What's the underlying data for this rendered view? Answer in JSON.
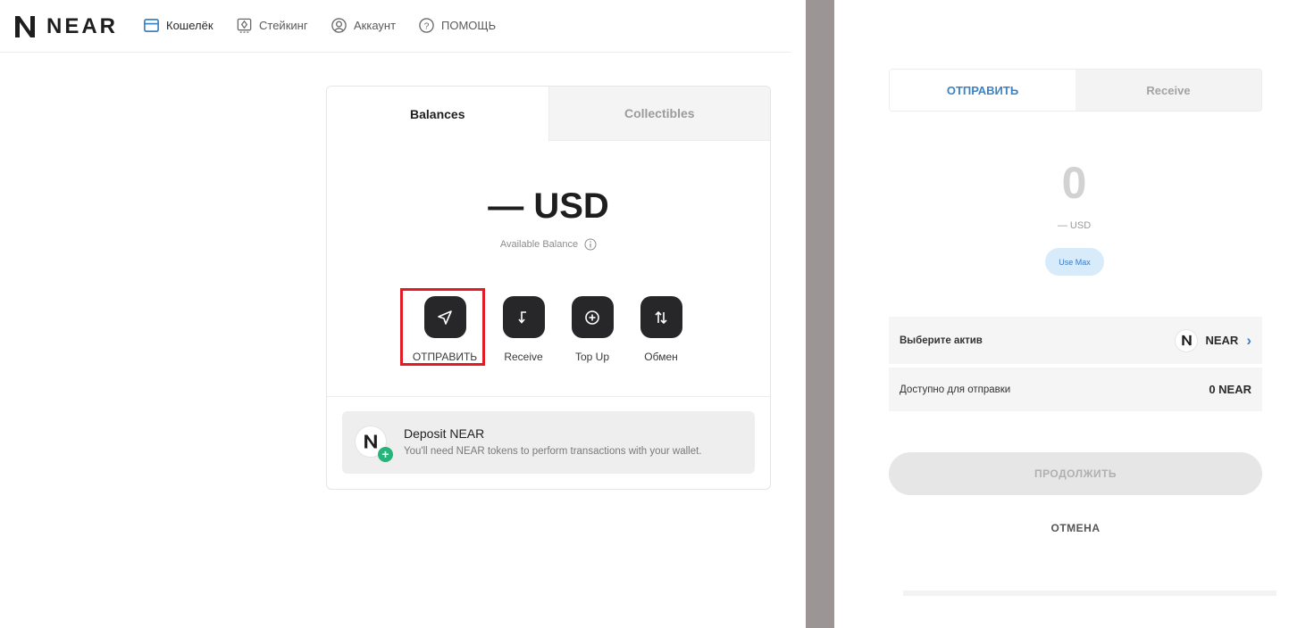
{
  "nav": {
    "logo_text": "NEAR",
    "items": [
      {
        "label": "Кошелёк",
        "icon": "wallet-icon"
      },
      {
        "label": "Стейкинг",
        "icon": "staking-icon"
      },
      {
        "label": "Аккаунт",
        "icon": "account-icon"
      },
      {
        "label": "ПОМОЩЬ",
        "icon": "help-icon"
      }
    ]
  },
  "wallet": {
    "tabs": [
      "Balances",
      "Collectibles"
    ],
    "balance": "— USD",
    "available_label": "Available Balance",
    "actions": [
      {
        "label": "ОТПРАВИТЬ",
        "icon": "send-icon"
      },
      {
        "label": "Receive",
        "icon": "receive-icon"
      },
      {
        "label": "Top Up",
        "icon": "top-up-icon"
      },
      {
        "label": "Обмен",
        "icon": "swap-icon"
      }
    ],
    "deposit": {
      "title": "Deposit NEAR",
      "subtitle": "You'll need NEAR tokens to perform transactions with your wallet."
    }
  },
  "send_form": {
    "tabs": [
      "ОТПРАВИТЬ",
      "Receive"
    ],
    "amount": "0",
    "usd": "— USD",
    "use_max": "Use Max",
    "select_asset_label": "Выберите актив",
    "asset": "NEAR",
    "available_label": "Доступно для отправки",
    "available_value": "0 NEAR",
    "continue_label": "ПРОДОЛЖИТЬ",
    "cancel_label": "ОТМЕНА"
  },
  "colors": {
    "accent_blue": "#3c83c6",
    "dark_button": "#272729",
    "highlight_red": "#e21c25",
    "deposit_green": "#22b67a"
  }
}
